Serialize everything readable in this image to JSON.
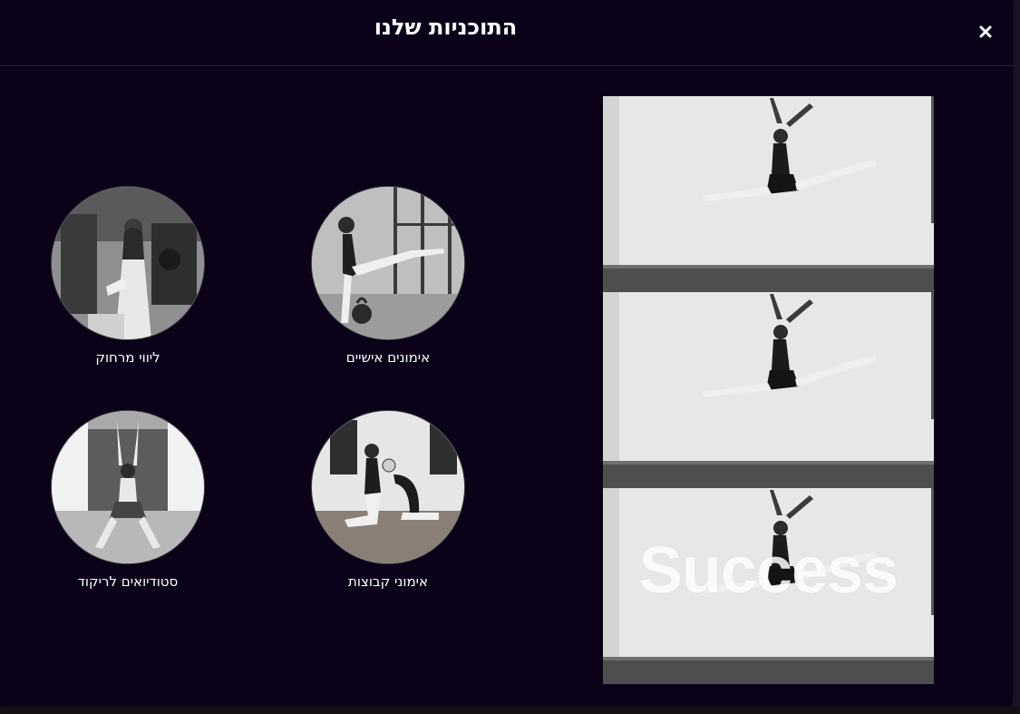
{
  "modal": {
    "title": "התוכניות שלנו",
    "close_icon": "close-icon"
  },
  "programs": [
    {
      "label": "אימונים אישיים",
      "icon": "kettlebell-training-photo"
    },
    {
      "label": "ליווי מרחוק",
      "icon": "gym-remote-coaching-photo"
    },
    {
      "label": "אימוני קבוצות",
      "icon": "group-stretching-photo"
    },
    {
      "label": "סטודיואים לריקוד",
      "icon": "dance-studio-photo"
    }
  ],
  "hero": {
    "watermark": "Success",
    "icon": "split-leap-dancer-photo"
  },
  "colors": {
    "background": "#0b0219",
    "text": "#ffffff",
    "divider": "#2a2140"
  }
}
